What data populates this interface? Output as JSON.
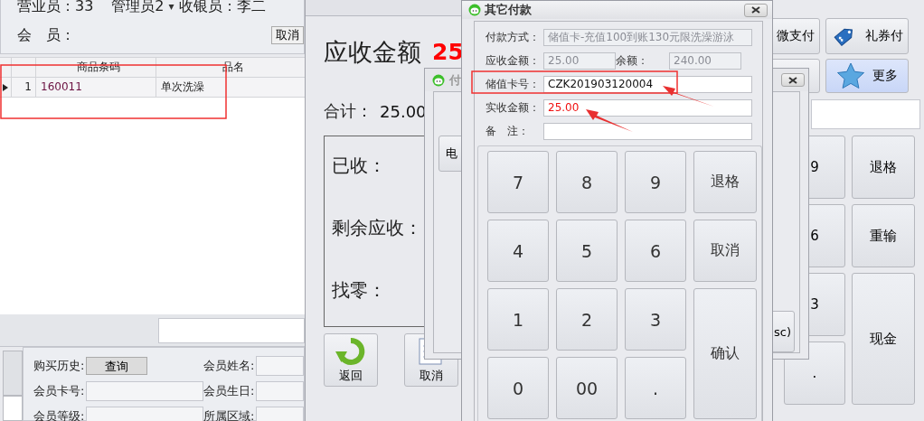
{
  "main_window": {
    "header": {
      "salesperson": "营业员：33",
      "admin": "管理员2",
      "admin_caret": "▾",
      "cashier": "收银员：李二",
      "member_label": "会　员：",
      "cancel_button": "取消"
    },
    "goods_table": {
      "columns": [
        "商品条码",
        "品名"
      ],
      "rows": [
        {
          "number": "1",
          "barcode": "160011",
          "name": "单次洗澡",
          "selected": true
        }
      ]
    },
    "member_form": [
      {
        "kind": "button",
        "label": "购买历史:",
        "button": "查询"
      },
      {
        "kind": "field",
        "label": "会员姓名:"
      },
      {
        "kind": "field",
        "label": "会员卡号:"
      },
      {
        "kind": "field",
        "label": "会员生日:"
      },
      {
        "kind": "field",
        "label": "会员等级:"
      },
      {
        "kind": "field",
        "label": "所属区域:"
      }
    ],
    "pay_buttons": [
      {
        "kind": "text",
        "label": "微支付"
      },
      {
        "kind": "tag",
        "label": "礼券付"
      },
      {
        "kind": "blank"
      },
      {
        "kind": "star",
        "label": "更多"
      }
    ],
    "keypad": [
      {
        "kind": "key",
        "label": "9"
      },
      {
        "kind": "key",
        "label": "退格"
      },
      {
        "kind": "key",
        "label": "6"
      },
      {
        "kind": "key",
        "label": "重输"
      },
      {
        "kind": "key",
        "label": "3"
      },
      {
        "kind": "tall",
        "label": "现金"
      },
      {
        "kind": "key",
        "label": "."
      }
    ]
  },
  "settle_window": {
    "amount_label": "应收金额",
    "amount": "25",
    "total_label": "合计：",
    "total": "25.00",
    "summary": [
      "已收：",
      "剩余应收：",
      "找零："
    ],
    "buttons": [
      {
        "kind": "back",
        "label": "返回"
      },
      {
        "kind": "cancel",
        "label": "取消"
      }
    ]
  },
  "pay_window": {
    "title": "付",
    "buttons": [
      {
        "kind": "left",
        "label": "电"
      },
      {
        "kind": "right",
        "label": "sc)"
      }
    ]
  },
  "other_payment_window": {
    "title": "其它付款",
    "fields": [
      {
        "kind": "full",
        "label": "付款方式：",
        "value": "储值卡-充值100到账130元限洗澡游泳",
        "disabled": true
      },
      {
        "kind": "half",
        "label": "应收金额：",
        "value": "25.00",
        "disabled": true
      },
      {
        "kind": "half",
        "label": "余额：",
        "value": "240.00",
        "disabled": true
      },
      {
        "kind": "full",
        "label": "储值卡号：",
        "value": "CZK201903120004",
        "disabled": false
      },
      {
        "kind": "full",
        "label": "实收金额：",
        "value": "25.00",
        "disabled": false,
        "emphasis": true
      },
      {
        "kind": "full",
        "label": "备　注：",
        "disabled": false
      }
    ],
    "keypad": [
      {
        "kind": "key",
        "label": "7"
      },
      {
        "kind": "key",
        "label": "8"
      },
      {
        "kind": "key",
        "label": "9"
      },
      {
        "kind": "key",
        "label": "退格"
      },
      {
        "kind": "key",
        "label": "4"
      },
      {
        "kind": "key",
        "label": "5"
      },
      {
        "kind": "key",
        "label": "6"
      },
      {
        "kind": "key",
        "label": "取消"
      },
      {
        "kind": "key",
        "label": "1"
      },
      {
        "kind": "key",
        "label": "2"
      },
      {
        "kind": "key",
        "label": "3"
      },
      {
        "kind": "tall",
        "label": "确认"
      },
      {
        "kind": "key",
        "label": "0"
      },
      {
        "kind": "key",
        "label": "00"
      },
      {
        "kind": "key",
        "label": "."
      }
    ]
  }
}
